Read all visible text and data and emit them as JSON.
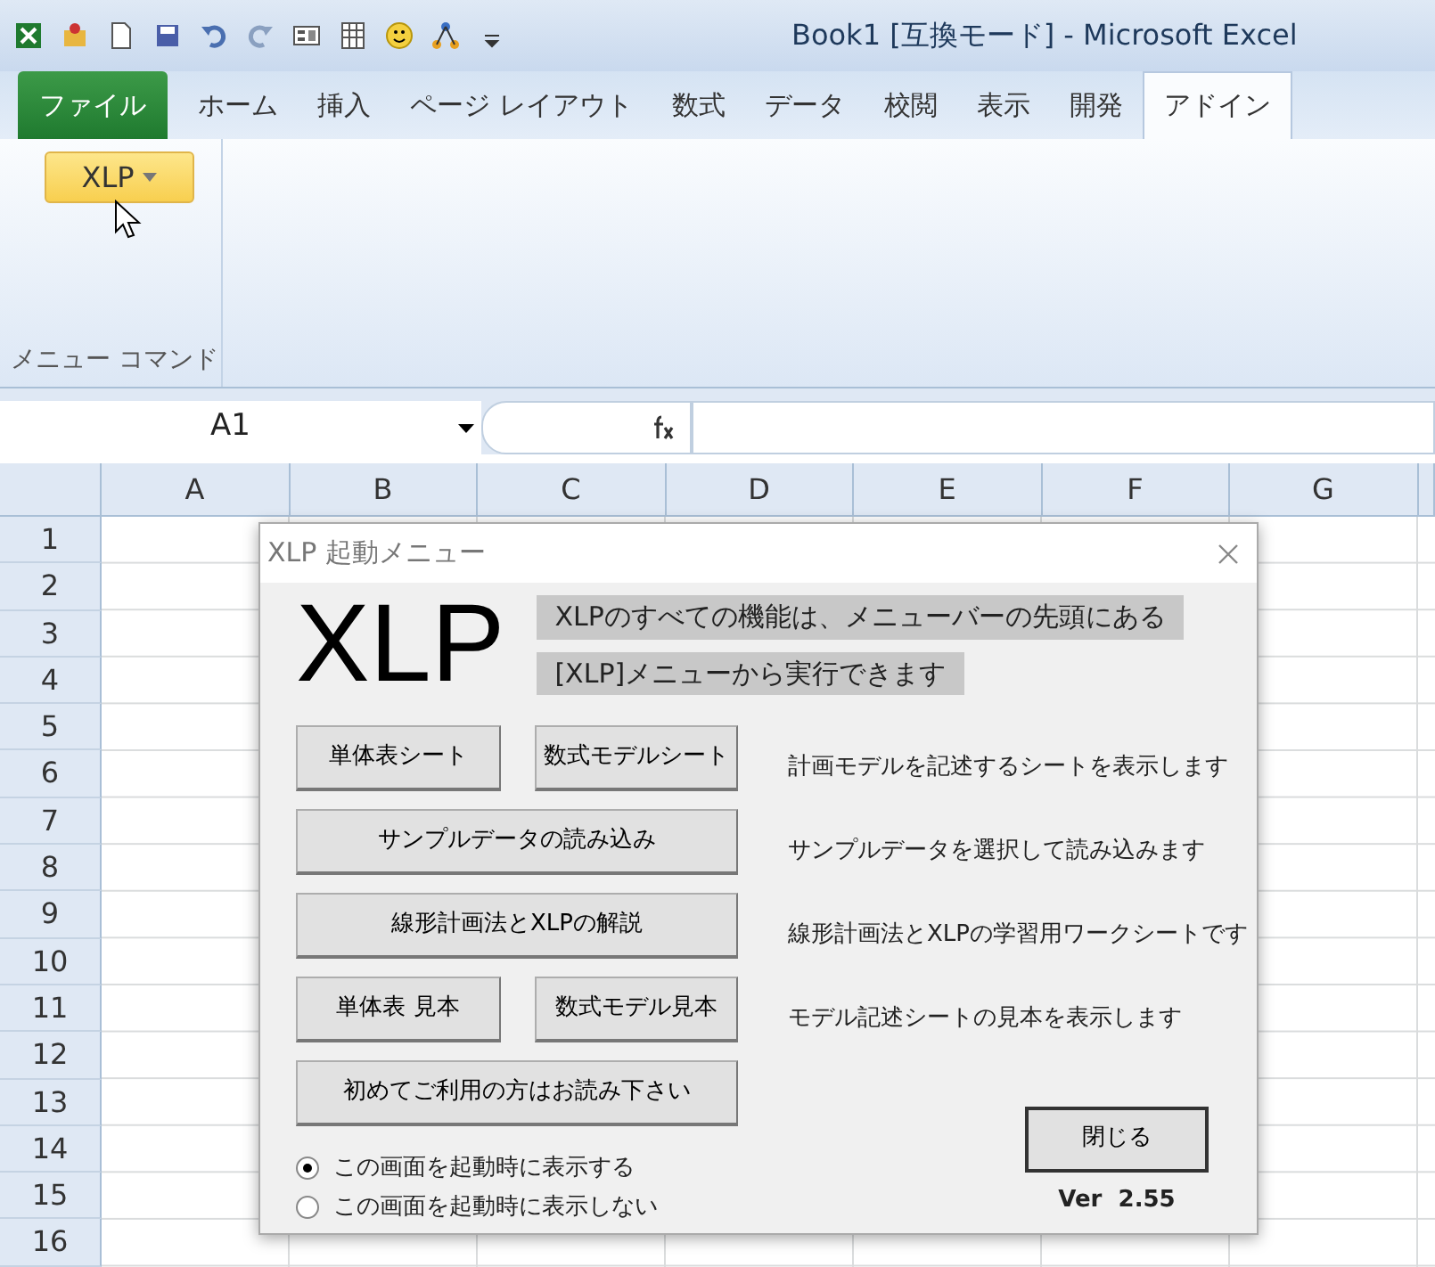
{
  "window": {
    "title": "Book1  [互換モード] - Microsoft Excel"
  },
  "tabs": [
    {
      "label": "ファイル",
      "kind": "file",
      "selected": false
    },
    {
      "label": "ホーム",
      "kind": "tab",
      "selected": false
    },
    {
      "label": "挿入",
      "kind": "tab",
      "selected": false
    },
    {
      "label": "ページ レイアウト",
      "kind": "tab",
      "selected": false
    },
    {
      "label": "数式",
      "kind": "tab",
      "selected": false
    },
    {
      "label": "データ",
      "kind": "tab",
      "selected": false
    },
    {
      "label": "校閲",
      "kind": "tab",
      "selected": false
    },
    {
      "label": "表示",
      "kind": "tab",
      "selected": false
    },
    {
      "label": "開発",
      "kind": "tab",
      "selected": false
    },
    {
      "label": "アドイン",
      "kind": "tab",
      "selected": true
    }
  ],
  "ribbon": {
    "button": "XLP",
    "group_label": "メニュー コマンド"
  },
  "formula_bar": {
    "name_box": "A1"
  },
  "sheet": {
    "columns": [
      "A",
      "B",
      "C",
      "D",
      "E",
      "F",
      "G"
    ],
    "rows": [
      "1",
      "2",
      "3",
      "4",
      "5",
      "6",
      "7",
      "8",
      "9",
      "10",
      "11",
      "12",
      "13",
      "14",
      "15",
      "16"
    ]
  },
  "dialog": {
    "title": "XLP 起動メニュー",
    "logo": "XLP",
    "banner_lines": [
      "XLPのすべての機能は、メニューバーの先頭にある",
      "[XLP]メニューから実行できます"
    ],
    "actions": [
      {
        "buttons": [
          "単体表シート",
          "数式モデルシート"
        ],
        "description": "計画モデルを記述するシートを表示します"
      },
      {
        "buttons": [
          "サンプルデータの読み込み"
        ],
        "description": "サンプルデータを選択して読み込みます"
      },
      {
        "buttons": [
          "線形計画法とXLPの解説"
        ],
        "description": "線形計画法とXLPの学習用ワークシートです"
      },
      {
        "buttons": [
          "単体表 見本",
          "数式モデル見本"
        ],
        "description": "モデル記述シートの見本を表示します"
      },
      {
        "buttons": [
          "初めてご利用の方はお読み下さい"
        ]
      }
    ],
    "radios": [
      {
        "label": "この画面を起動時に表示する",
        "selected": true
      },
      {
        "label": "この画面を起動時に表示しない",
        "selected": false
      }
    ],
    "close_button": "閉じる",
    "version": "Ver  2.55"
  }
}
